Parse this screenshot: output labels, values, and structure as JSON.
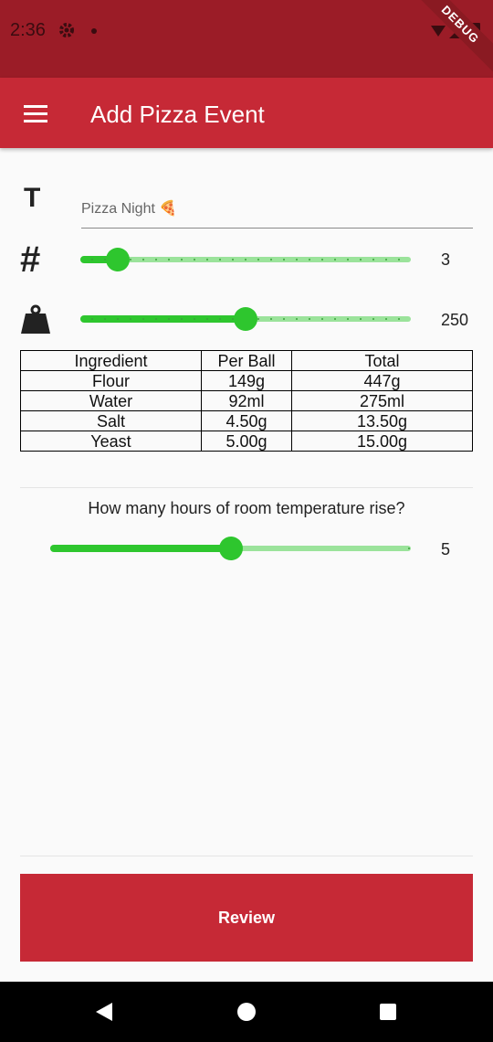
{
  "status_bar": {
    "time": "2:36",
    "debug_label": "DEBUG"
  },
  "app_bar": {
    "title": "Add Pizza Event",
    "menu_icon": "menu-icon"
  },
  "form": {
    "title_field": {
      "value": "Pizza Night 🍕",
      "icon": "title-icon",
      "icon_glyph": "T"
    },
    "balls": {
      "icon": "hash-icon",
      "icon_glyph": "#",
      "value": 3,
      "min": 1,
      "max": 25,
      "display": "3"
    },
    "weight": {
      "icon": "weight-icon",
      "value": 250,
      "min": 0,
      "max": 500,
      "display": "250"
    }
  },
  "table": {
    "headers": [
      "Ingredient",
      "Per Ball",
      "Total"
    ],
    "rows": [
      [
        "Flour",
        "149g",
        "447g"
      ],
      [
        "Water",
        "92ml",
        "275ml"
      ],
      [
        "Salt",
        "4.50g",
        "13.50g"
      ],
      [
        "Yeast",
        "5.00g",
        "15.00g"
      ]
    ]
  },
  "rise": {
    "question": "How many hours of room temperature rise?",
    "value": 5,
    "min": 0,
    "max": 10,
    "display": "5"
  },
  "review_button": {
    "label": "Review"
  },
  "colors": {
    "primary": "#c62936",
    "status_bar": "#9b1c27",
    "slider_active": "#2ec62e",
    "slider_inactive": "#9be39b"
  }
}
